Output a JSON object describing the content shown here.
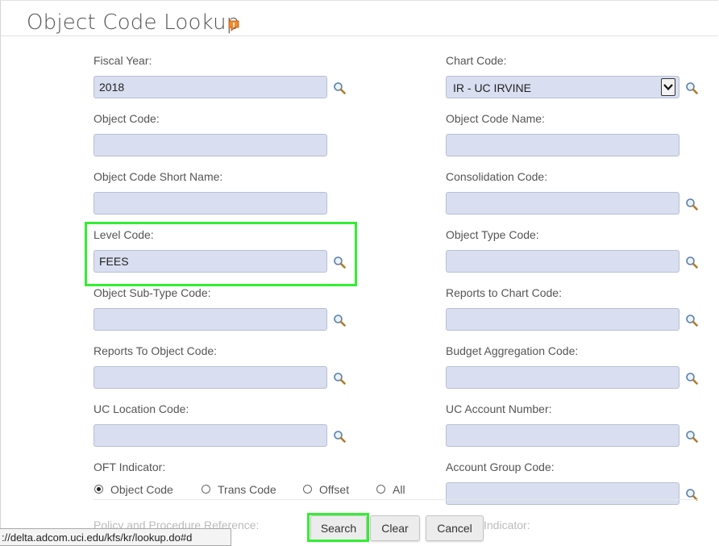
{
  "page": {
    "title": "Object Code Lookup",
    "help_icon": "help-flag-icon"
  },
  "form": {
    "left": [
      {
        "label": "Fiscal Year:",
        "value": "2018",
        "lookup": true
      },
      {
        "label": "Object Code:",
        "value": "",
        "lookup": false
      },
      {
        "label": "Object Code Short Name:",
        "value": "",
        "lookup": false
      },
      {
        "label": "Level Code:",
        "value": "FEES",
        "lookup": true
      },
      {
        "label": "Object Sub-Type Code:",
        "value": "",
        "lookup": true
      },
      {
        "label": "Reports To Object Code:",
        "value": "",
        "lookup": true
      },
      {
        "label": "UC Location Code:",
        "value": "",
        "lookup": true
      }
    ],
    "right": [
      {
        "label": "Chart Code:",
        "value": "IR - UC IRVINE",
        "lookup": true
      },
      {
        "label": "Object Code Name:",
        "value": "",
        "lookup": false
      },
      {
        "label": "Consolidation Code:",
        "value": "",
        "lookup": true
      },
      {
        "label": "Object Type Code:",
        "value": "",
        "lookup": true
      },
      {
        "label": "Reports to Chart Code:",
        "value": "",
        "lookup": true
      },
      {
        "label": "Budget Aggregation Code:",
        "value": "",
        "lookup": true
      },
      {
        "label": "UC Account Number:",
        "value": "",
        "lookup": true
      },
      {
        "label": "Account Group Code:",
        "value": "",
        "lookup": true
      }
    ],
    "oft": {
      "label": "OFT Indicator:",
      "options": [
        "Object Code",
        "Trans Code",
        "Offset",
        "All"
      ],
      "selected": "Object Code"
    },
    "partial_labels": {
      "left": "Policy and Procedure Reference:",
      "right": "Indicator:"
    }
  },
  "buttons": {
    "search": "Search",
    "clear": "Clear",
    "cancel": "Cancel"
  },
  "status_bar": {
    "url": "://delta.adcom.uci.edu/kfs/kr/lookup.do#d"
  },
  "colors": {
    "field_bg": "#d9dff0",
    "highlight": "#33ee33"
  }
}
